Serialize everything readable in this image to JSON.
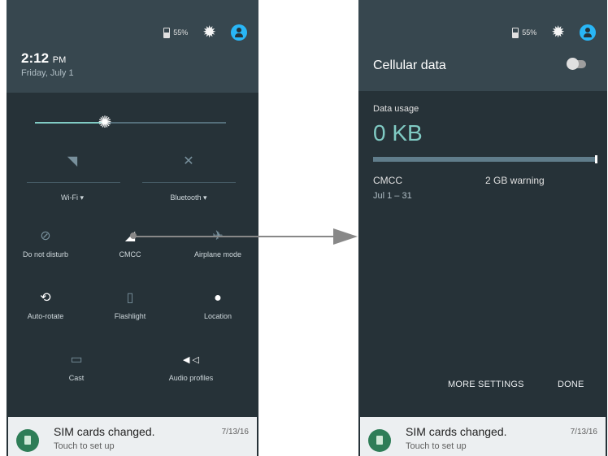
{
  "left": {
    "status": {
      "battery": "55%"
    },
    "time": "2:12",
    "ampm": "PM",
    "date": "Friday, July 1",
    "tiles": {
      "wifi": "Wi-Fi ▾",
      "bluetooth": "Bluetooth ▾",
      "dnd": "Do not disturb",
      "cmcc": "CMCC",
      "airplane": "Airplane mode",
      "autorotate": "Auto-rotate",
      "flashlight": "Flashlight",
      "location": "Location",
      "cast": "Cast",
      "audio": "Audio profiles"
    },
    "brightness_fraction": 0.36
  },
  "right": {
    "status": {
      "battery": "55%"
    },
    "title": "Cellular data",
    "data_usage_label": "Data usage",
    "data_usage_value": "0 KB",
    "carrier": "CMCC",
    "warning": "2 GB warning",
    "range": "Jul 1 – 31",
    "more_settings": "MORE SETTINGS",
    "done": "DONE"
  },
  "notification": {
    "title": "SIM cards changed.",
    "subtitle": "Touch to set up",
    "time": "7/13/16"
  },
  "colors": {
    "panel": "#263238",
    "header": "#37474f",
    "accent": "#80cbc4",
    "avatar": "#29b6f6"
  },
  "icons": [
    "battery-icon",
    "gear-icon",
    "account-icon",
    "brightness-icon",
    "wifi-off-icon",
    "bluetooth-off-icon",
    "dnd-icon",
    "signal-icon",
    "airplane-icon",
    "rotate-icon",
    "flashlight-icon",
    "location-icon",
    "cast-icon",
    "audio-profiles-icon",
    "sim-icon"
  ]
}
